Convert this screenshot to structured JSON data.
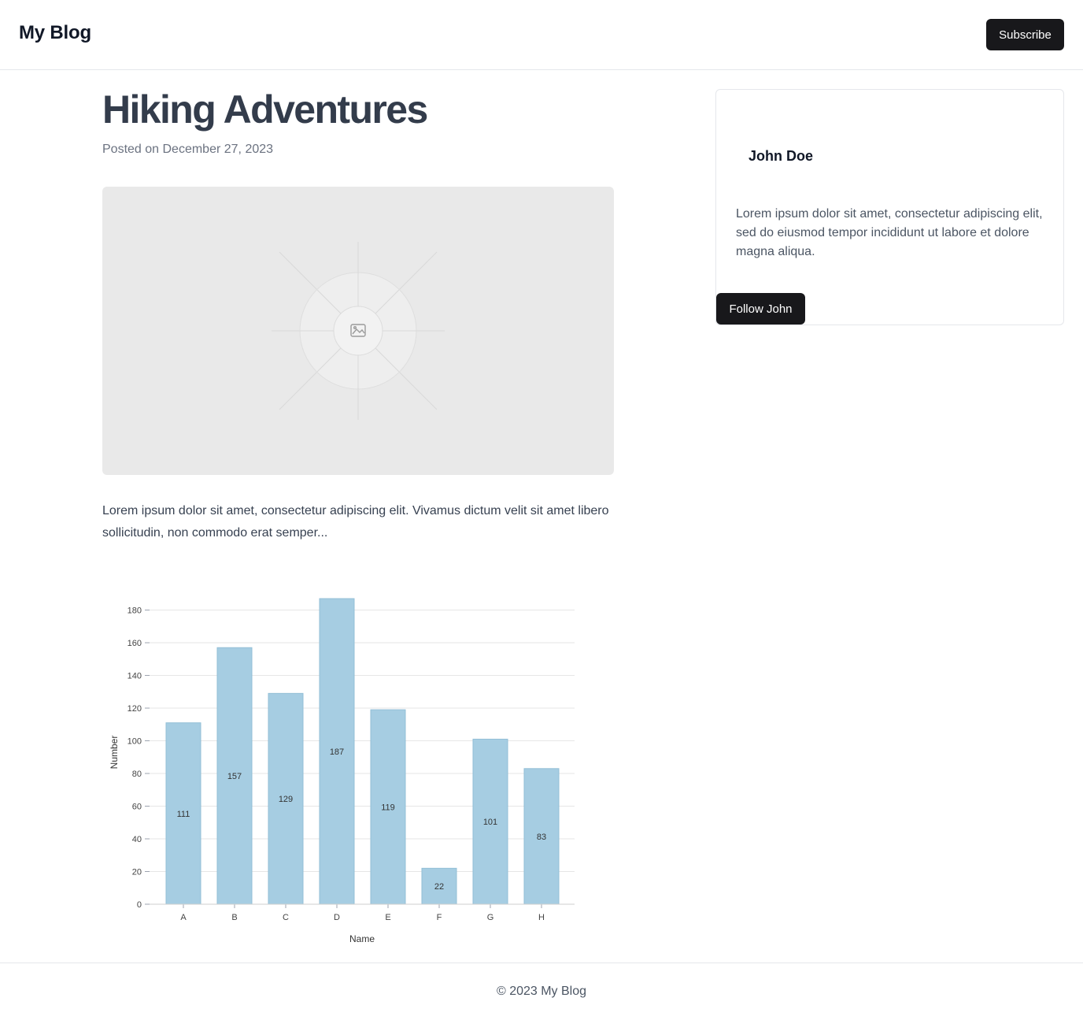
{
  "header": {
    "brand": "My Blog",
    "subscribe_label": "Subscribe"
  },
  "post": {
    "title": "Hiking Adventures",
    "date": "Posted on December 27, 2023",
    "body": "Lorem ipsum dolor sit amet, consectetur adipiscing elit. Vivamus dictum velit sit amet libero sollicitudin, non commodo erat semper..."
  },
  "author": {
    "name": "John Doe",
    "bio": "Lorem ipsum dolor sit amet, consectetur adipiscing elit, sed do eiusmod tempor incididunt ut labore et dolore magna aliqua.",
    "follow_label": "Follow John"
  },
  "footer": {
    "text": "© 2023 My Blog"
  },
  "chart_data": {
    "type": "bar",
    "categories": [
      "A",
      "B",
      "C",
      "D",
      "E",
      "F",
      "G",
      "H"
    ],
    "values": [
      111,
      157,
      129,
      187,
      119,
      22,
      101,
      83
    ],
    "xlabel": "Name",
    "ylabel": "Number",
    "ylim": [
      0,
      180
    ],
    "yticks": [
      0,
      20,
      40,
      60,
      80,
      100,
      120,
      140,
      160,
      180
    ],
    "grid": true,
    "bar_color": "#a6cde2"
  }
}
